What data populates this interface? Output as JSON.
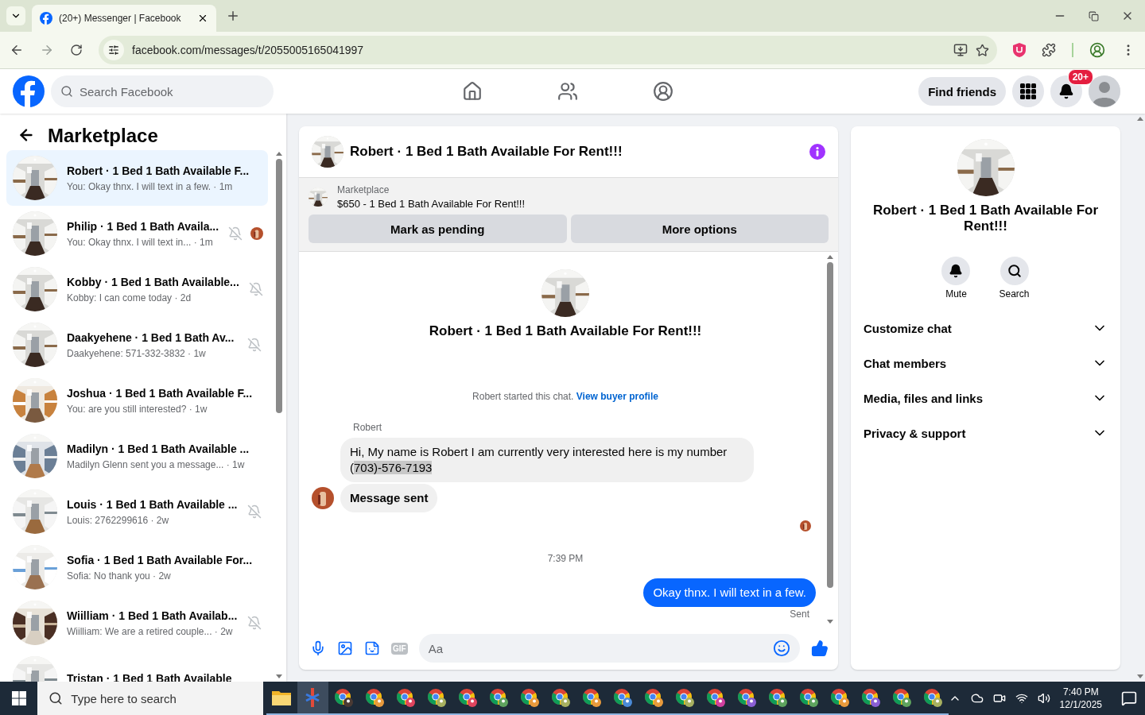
{
  "browser": {
    "tab_title": "(20+) Messenger | Facebook",
    "url": "facebook.com/messages/t/2055005165041997"
  },
  "header": {
    "search_placeholder": "Search Facebook",
    "find_friends": "Find friends",
    "notification_badge": "20+"
  },
  "sidebar": {
    "title": "Marketplace",
    "conversations": [
      {
        "title": "Robert · 1 Bed 1 Bath Available F...",
        "preview": "You: Okay thnx. I will text in a few. · 1m",
        "selected": true,
        "muted": false,
        "seen": false
      },
      {
        "title": "Philip · 1 Bed 1 Bath Availa...",
        "preview": "You: Okay thnx. I will text in... · 1m",
        "selected": false,
        "muted": true,
        "seen": true
      },
      {
        "title": "Kobby · 1 Bed 1 Bath Available...",
        "preview": "Kobby: I can come today · 2d",
        "selected": false,
        "muted": true,
        "seen": false
      },
      {
        "title": "Daakyehene · 1 Bed 1 Bath Av...",
        "preview": "Daakyehene: 571-332-3832 · 1w",
        "selected": false,
        "muted": true,
        "seen": false
      },
      {
        "title": "Joshua · 1 Bed 1 Bath Available F...",
        "preview": "You: are you still interested? · 1w",
        "selected": false,
        "muted": false,
        "seen": false
      },
      {
        "title": "Madilyn · 1 Bed 1 Bath Available ...",
        "preview": "Madilyn Glenn sent you a message... · 1w",
        "selected": false,
        "muted": false,
        "seen": false
      },
      {
        "title": "Louis · 1 Bed 1 Bath Available ...",
        "preview": "Louis: 2762299616 · 2w",
        "selected": false,
        "muted": true,
        "seen": false
      },
      {
        "title": "Sofia · 1 Bed 1 Bath Available For...",
        "preview": "Sofia: No thank you · 2w",
        "selected": false,
        "muted": false,
        "seen": false
      },
      {
        "title": "Wiilliam · 1 Bed 1 Bath Availab...",
        "preview": "Wiilliam: We are a retired couple... · 2w",
        "selected": false,
        "muted": true,
        "seen": false
      },
      {
        "title": "Tristan · 1 Bed 1 Bath Available",
        "selected": false,
        "muted": false,
        "seen": false
      }
    ]
  },
  "chat": {
    "title": "Robert · 1 Bed 1 Bath Available For Rent!!!",
    "listing": {
      "label": "Marketplace",
      "text": "$650 - 1 Bed 1 Bath Available For Rent!!!"
    },
    "actions": [
      "Mark as pending",
      "More options"
    ],
    "intro_title": "Robert · 1 Bed 1 Bath Available For Rent!!!",
    "intro_text": "Robert started this chat.",
    "intro_link": "View buyer profile",
    "messages": [
      {
        "kind": "incoming",
        "sender": "Robert",
        "text": "Hi, My name is Robert I am currently very interested here is my number (",
        "highlight": "703)-576-7193"
      },
      {
        "kind": "notice",
        "text": "Message sent"
      },
      {
        "kind": "seen"
      },
      {
        "kind": "time",
        "text": "7:39 PM"
      },
      {
        "kind": "outgoing",
        "text": "Okay thnx. I will text in a few.",
        "status": "Sent"
      }
    ],
    "composer": {
      "gif": "GIF",
      "placeholder": "Aa"
    }
  },
  "details": {
    "title": "Robert · 1 Bed 1 Bath Available For Rent!!!",
    "actions": [
      {
        "kind": "mute",
        "label": "Mute"
      },
      {
        "kind": "search",
        "label": "Search"
      }
    ],
    "sections": [
      {
        "label": "Customize chat",
        "expanded": false
      },
      {
        "label": "Chat members",
        "expanded": false
      },
      {
        "label": "Media, files and links",
        "expanded": false
      },
      {
        "label": "Privacy & support",
        "expanded": false
      }
    ]
  },
  "taskbar": {
    "search_placeholder": "Type here to search",
    "time": "7:40 PM",
    "date": "12/1/2025",
    "apps": [
      {
        "kind": "explorer",
        "selected": false
      },
      {
        "kind": "app",
        "selected": true
      },
      {
        "kind": "chrome",
        "selected": false,
        "color": "#4a3a34"
      },
      {
        "kind": "chrome",
        "selected": false,
        "color": "#e89a3c"
      },
      {
        "kind": "chrome",
        "selected": false,
        "color": "#e0455e"
      },
      {
        "kind": "chrome",
        "selected": false,
        "color": "#a7b060"
      },
      {
        "kind": "chrome",
        "selected": false,
        "color": "#e0455e"
      },
      {
        "kind": "chrome",
        "selected": false,
        "color": "#5ea35e"
      },
      {
        "kind": "chrome",
        "selected": false,
        "color": "#e89a3c"
      },
      {
        "kind": "chrome",
        "selected": false,
        "color": "#a7b060"
      },
      {
        "kind": "chrome",
        "selected": false,
        "color": "#e89a3c"
      },
      {
        "kind": "chrome",
        "selected": false,
        "color": "#4a8ad6"
      },
      {
        "kind": "chrome",
        "selected": false,
        "color": "#e89a3c"
      },
      {
        "kind": "chrome",
        "selected": false,
        "color": "#a7b060"
      },
      {
        "kind": "chrome",
        "selected": false,
        "color": "#d0409e"
      },
      {
        "kind": "chrome",
        "selected": false,
        "color": "#8a5fd4"
      },
      {
        "kind": "chrome",
        "selected": false,
        "color": "#5ea35e"
      },
      {
        "kind": "chrome",
        "selected": false,
        "color": "#5ea35e"
      },
      {
        "kind": "chrome",
        "selected": false,
        "color": "#e89a3c"
      },
      {
        "kind": "chrome",
        "selected": false,
        "color": "#8a5fd4"
      },
      {
        "kind": "chrome",
        "selected": false,
        "color": "#5ea35e"
      },
      {
        "kind": "chrome",
        "selected": false,
        "color": "#a7b060"
      }
    ]
  }
}
